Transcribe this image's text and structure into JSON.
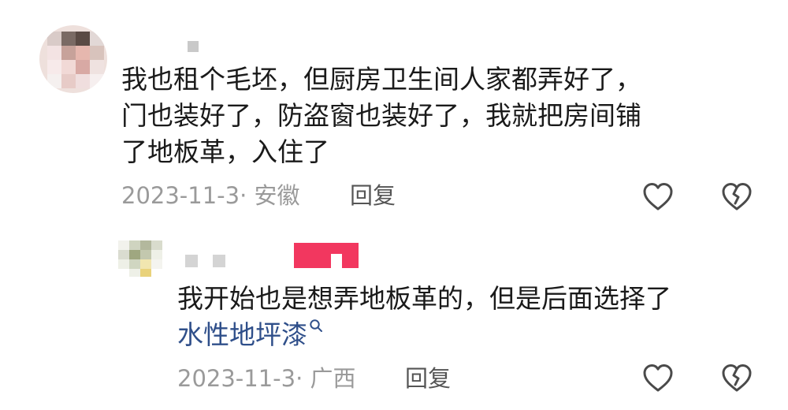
{
  "comment": {
    "lines": [
      "我也租个毛坯，但厨房卫生间人家都弄好了，",
      "门也装好了，防盗窗也装好了，我就把房间铺",
      "了地板革，入住了"
    ],
    "meta": "2023-11-3· 安徽",
    "reply_label": "回复",
    "like_icon": "heart-outline-icon",
    "dislike_icon": "broken-heart-icon"
  },
  "reply": {
    "line1": "我开始也是想弄地板革的，但是后面选择了",
    "link_text": "水性地坪漆",
    "meta": "2023-11-3· 广西",
    "reply_label": "回复",
    "like_icon": "heart-outline-icon",
    "dislike_icon": "broken-heart-icon"
  },
  "colors": {
    "text": "#1a1a1a",
    "meta": "#9a9a9a",
    "link": "#2f4f8a",
    "tag": "#f2375f"
  }
}
